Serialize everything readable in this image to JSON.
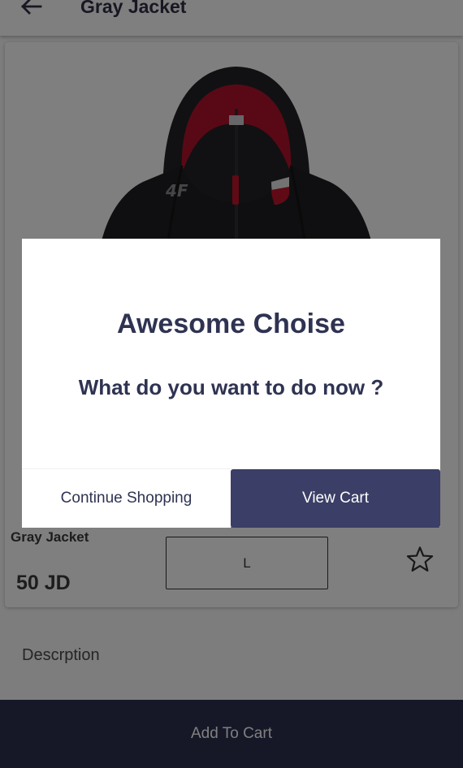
{
  "appbar": {
    "title": "Gray Jacket",
    "back_icon": "arrow-left-icon"
  },
  "product": {
    "name": "Gray Jacket",
    "price": "50 JD",
    "size": "L",
    "favorite_icon": "star-outline-icon",
    "image": "gray-hooded-jacket-photo"
  },
  "description_label": "Descrption",
  "add_to_cart_label": "Add To Cart",
  "dialog": {
    "title": "Awesome Choise",
    "message": "What do you want to do now ?",
    "continue_label": "Continue Shopping",
    "view_cart_label": "View Cart"
  },
  "colors": {
    "primary_dark": "#2d3050",
    "dialog_button": "#3b3e66",
    "title_text": "#2f3352",
    "jacket_body": "#1f1f22",
    "jacket_hood_lining": "#b3122a"
  }
}
